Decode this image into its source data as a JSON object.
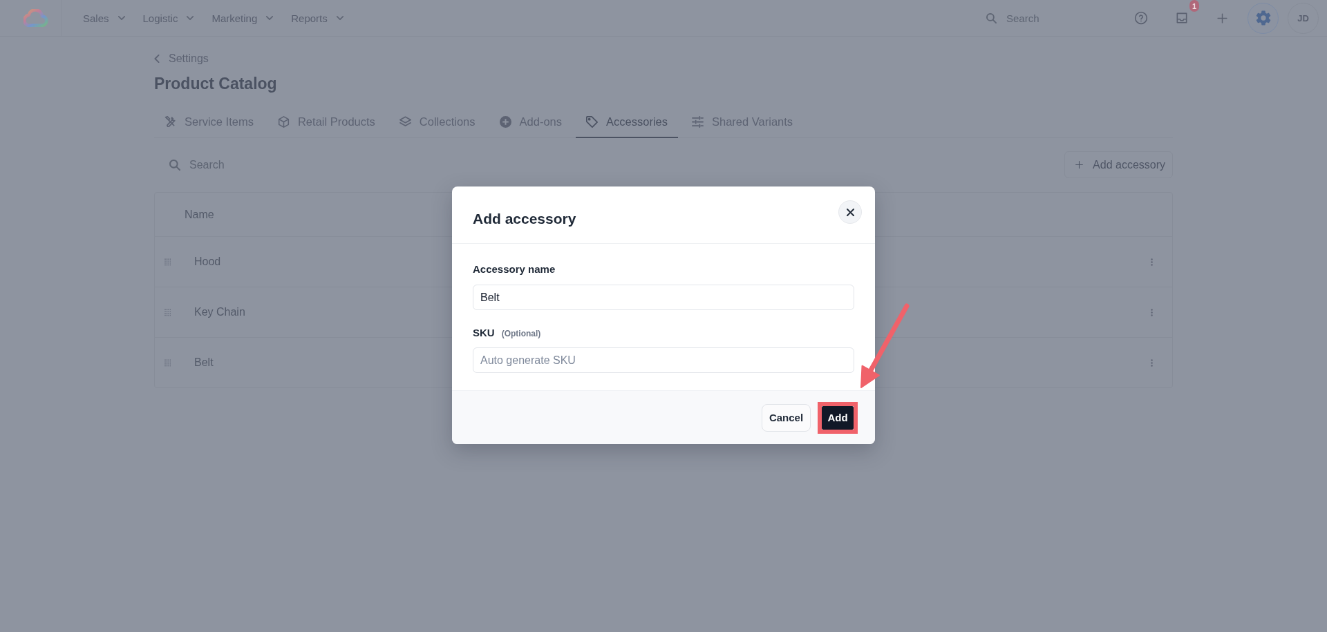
{
  "top_bar": {
    "nav": [
      "Sales",
      "Logistic",
      "Marketing",
      "Reports"
    ],
    "search": {
      "placeholder": "Search"
    },
    "inbox_badge": "1",
    "avatar": "JD"
  },
  "header": {
    "back_link": "Settings",
    "title": "Product Catalog"
  },
  "tabs": [
    {
      "label": "Service Items",
      "selected": false
    },
    {
      "label": "Retail Products",
      "selected": false
    },
    {
      "label": "Collections",
      "selected": false
    },
    {
      "label": "Add-ons",
      "selected": false
    },
    {
      "label": "Accessories",
      "selected": true
    },
    {
      "label": "Shared Variants",
      "selected": false
    }
  ],
  "toolbar": {
    "search": {
      "placeholder": "Search"
    },
    "add_button": "Add accessory"
  },
  "table": {
    "columns": [
      "Name"
    ],
    "rows": [
      {
        "name": "Hood"
      },
      {
        "name": "Key Chain"
      },
      {
        "name": "Belt"
      }
    ]
  },
  "dialog": {
    "title": "Add accessory",
    "fields": [
      {
        "label": "Accessory name",
        "value": "Belt"
      },
      {
        "label": "SKU",
        "note": "(Optional)",
        "placeholder": "Auto generate SKU"
      }
    ],
    "buttons": [
      {
        "label": "Cancel",
        "kind": "secondary",
        "highlighted": false
      },
      {
        "label": "Add",
        "kind": "primary",
        "highlighted": true
      }
    ]
  }
}
